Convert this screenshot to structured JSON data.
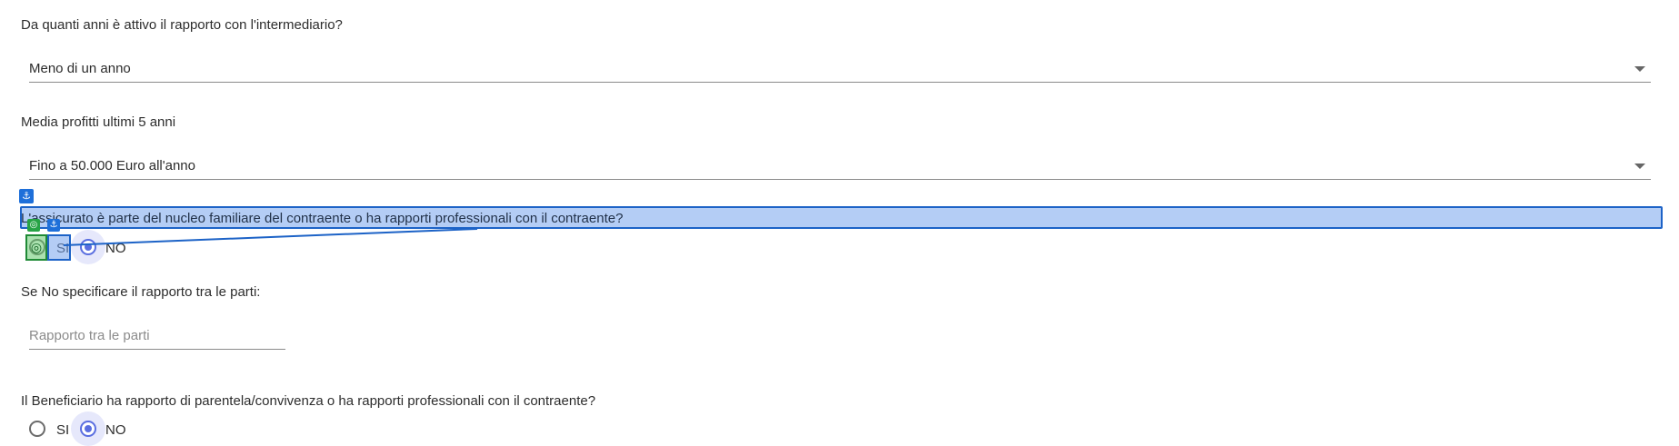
{
  "questions": {
    "q1": {
      "label": "Da quanti anni è attivo il rapporto con l'intermediario?",
      "value": "Meno di un anno"
    },
    "q2": {
      "label": "Media profitti ultimi 5 anni",
      "value": "Fino a 50.000 Euro all'anno"
    },
    "q3": {
      "label": "L'assicurato è parte del nucleo familiare del contraente o ha rapporti professionali con il contraente?",
      "option_si": "SI",
      "option_no": "NO",
      "selected": "NO"
    },
    "q4": {
      "label": "Se No specificare il rapporto tra le parti:",
      "placeholder": "Rapporto tra le parti"
    },
    "q5": {
      "label": "Il Beneficiario ha rapporto di parentela/convivenza o ha rapporti professionali con il contraente?",
      "option_si": "SI",
      "option_no": "NO",
      "selected": "NO"
    }
  },
  "overlay": {
    "anchor_icon": "anchor-icon",
    "target_icon": "target-icon",
    "accent": "#1e6fd9",
    "target_color": "#27a345"
  }
}
